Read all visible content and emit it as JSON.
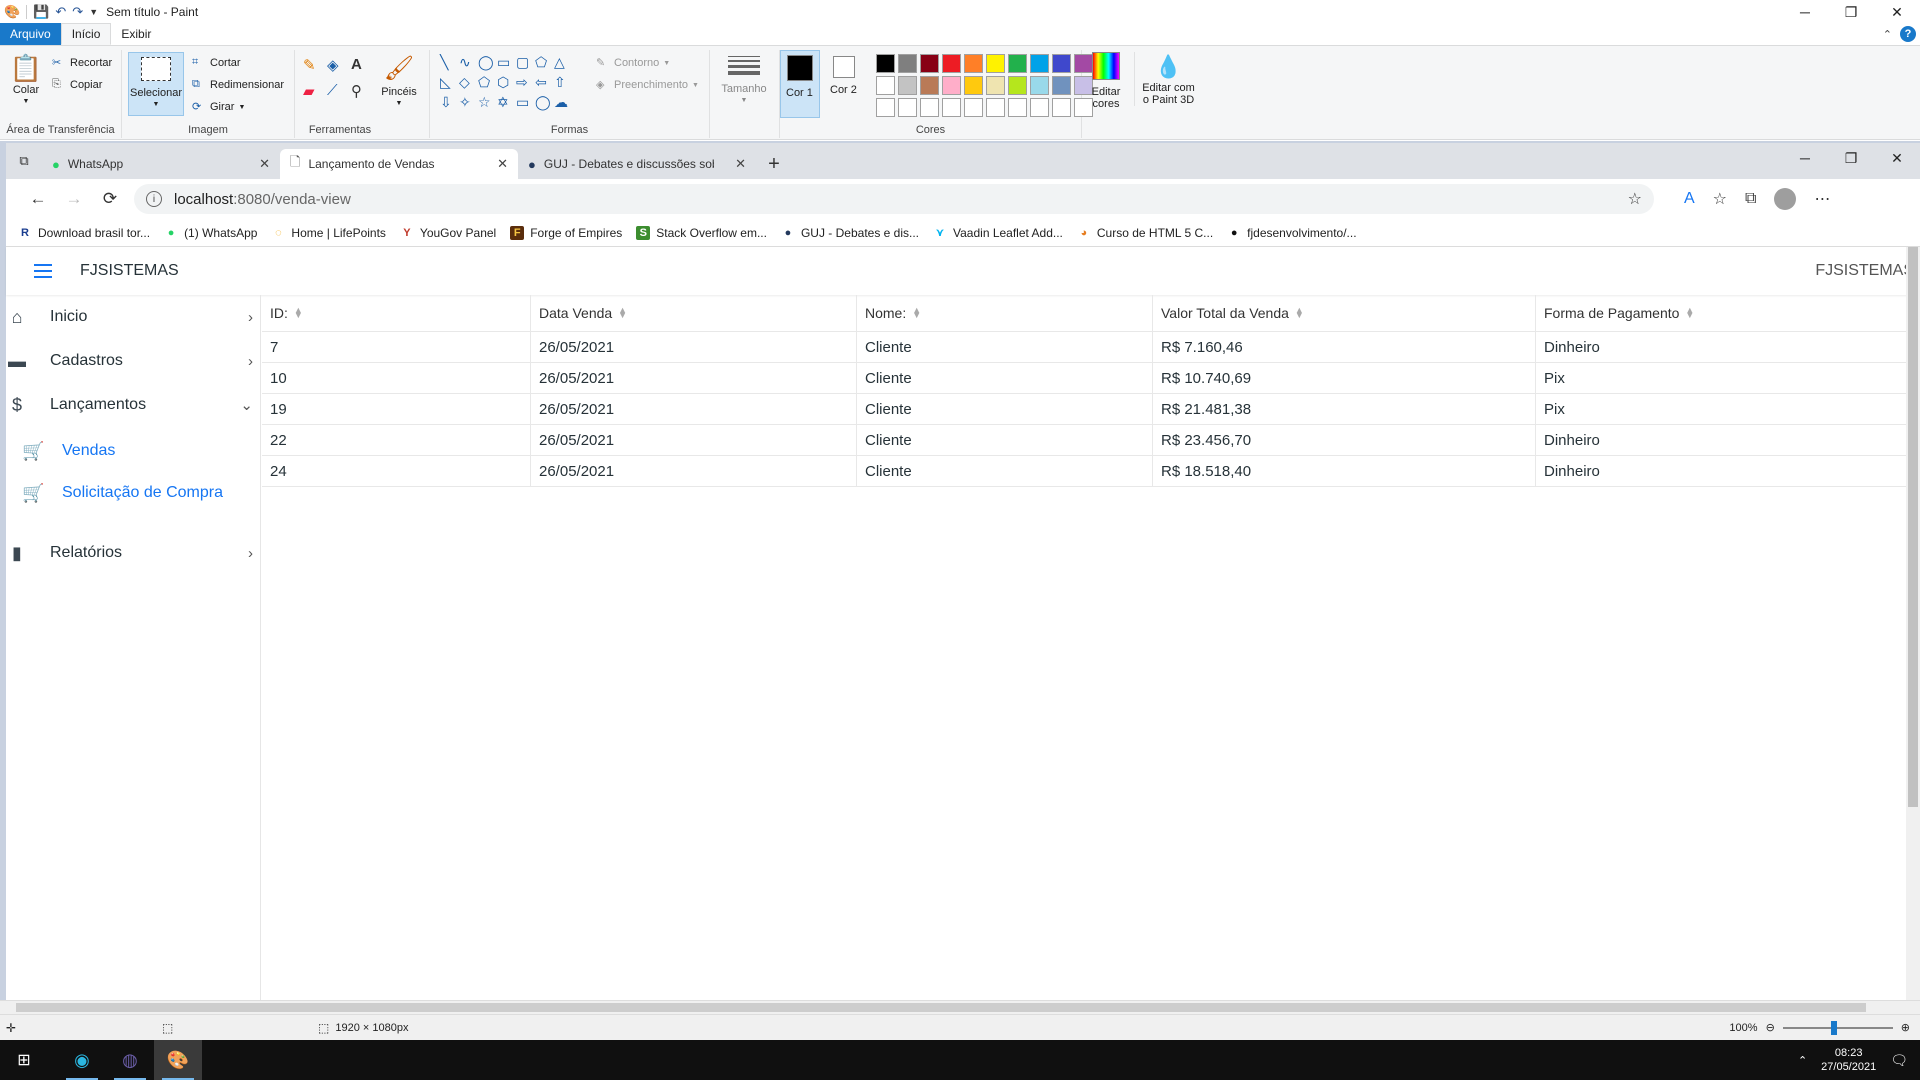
{
  "paint": {
    "title": "Sem título - Paint",
    "tabs": {
      "file": "Arquivo",
      "home": "Início",
      "view": "Exibir"
    },
    "groups": {
      "clipboard": {
        "label": "Área de Transferência",
        "paste": "Colar",
        "cut": "Recortar",
        "copy": "Copiar"
      },
      "image": {
        "label": "Imagem",
        "select": "Selecionar",
        "crop": "Cortar",
        "resize": "Redimensionar",
        "rotate": "Girar"
      },
      "tools": {
        "label": "Ferramentas",
        "brushes": "Pincéis"
      },
      "shapes": {
        "label": "Formas",
        "outline": "Contorno",
        "fill": "Preenchimento",
        "size": "Tamanho"
      },
      "colors": {
        "label": "Cores",
        "color1": "Cor 1",
        "color2": "Cor 2",
        "edit": "Editar cores",
        "paint3d": "Editar com o Paint 3D",
        "palette_row1": [
          "#000000",
          "#7f7f7f",
          "#880015",
          "#ed1c24",
          "#ff7f27",
          "#fff200",
          "#22b14c",
          "#00a2e8",
          "#3f48cc",
          "#a349a4"
        ],
        "palette_row2": [
          "#ffffff",
          "#c3c3c3",
          "#b97a57",
          "#ffaec9",
          "#ffc90e",
          "#efe4b0",
          "#b5e61d",
          "#99d9ea",
          "#7092be",
          "#c8bfe7"
        ],
        "palette_row3": [
          "#ffffff",
          "#ffffff",
          "#ffffff",
          "#ffffff",
          "#ffffff",
          "#ffffff",
          "#ffffff",
          "#ffffff",
          "#ffffff",
          "#ffffff"
        ]
      }
    },
    "status": {
      "dimensions": "1920 × 1080px",
      "zoom": "100%"
    }
  },
  "browser": {
    "tabs": [
      {
        "label": "WhatsApp",
        "active": false
      },
      {
        "label": "Lançamento de Vendas",
        "active": true
      },
      {
        "label": "GUJ - Debates e discussões sobr",
        "active": false
      }
    ],
    "url": {
      "host": "localhost",
      "path": ":8080/venda-view"
    },
    "bookmarks": [
      "Download brasil tor...",
      "(1) WhatsApp",
      "Home | LifePoints",
      "YouGov Panel",
      "Forge of Empires",
      "Stack Overflow em...",
      "GUJ - Debates e dis...",
      "Vaadin Leaflet Add...",
      "Curso de HTML 5 C...",
      "fjdesenvolvimento/..."
    ]
  },
  "app": {
    "brand": "FJSISTEMAS",
    "brand_right": "FJSISTEMAS",
    "nav": {
      "inicio": "Inicio",
      "cadastros": "Cadastros",
      "lancamentos": "Lançamentos",
      "vendas": "Vendas",
      "solicitacao": "Solicitação de Compra",
      "relatorios": "Relatórios"
    },
    "grid": {
      "headers": [
        "ID:",
        "Data Venda",
        "Nome:",
        "Valor Total da Venda",
        "Forma de Pagamento"
      ],
      "rows": [
        [
          "7",
          "26/05/2021",
          "Cliente",
          "R$ 7.160,46",
          "Dinheiro"
        ],
        [
          "10",
          "26/05/2021",
          "Cliente",
          "R$ 10.740,69",
          "Pix"
        ],
        [
          "19",
          "26/05/2021",
          "Cliente",
          "R$ 21.481,38",
          "Pix"
        ],
        [
          "22",
          "26/05/2021",
          "Cliente",
          "R$ 23.456,70",
          "Dinheiro"
        ],
        [
          "24",
          "26/05/2021",
          "Cliente",
          "R$ 18.518,40",
          "Dinheiro"
        ]
      ]
    }
  },
  "taskbar": {
    "time": "08:23",
    "date": "27/05/2021"
  }
}
